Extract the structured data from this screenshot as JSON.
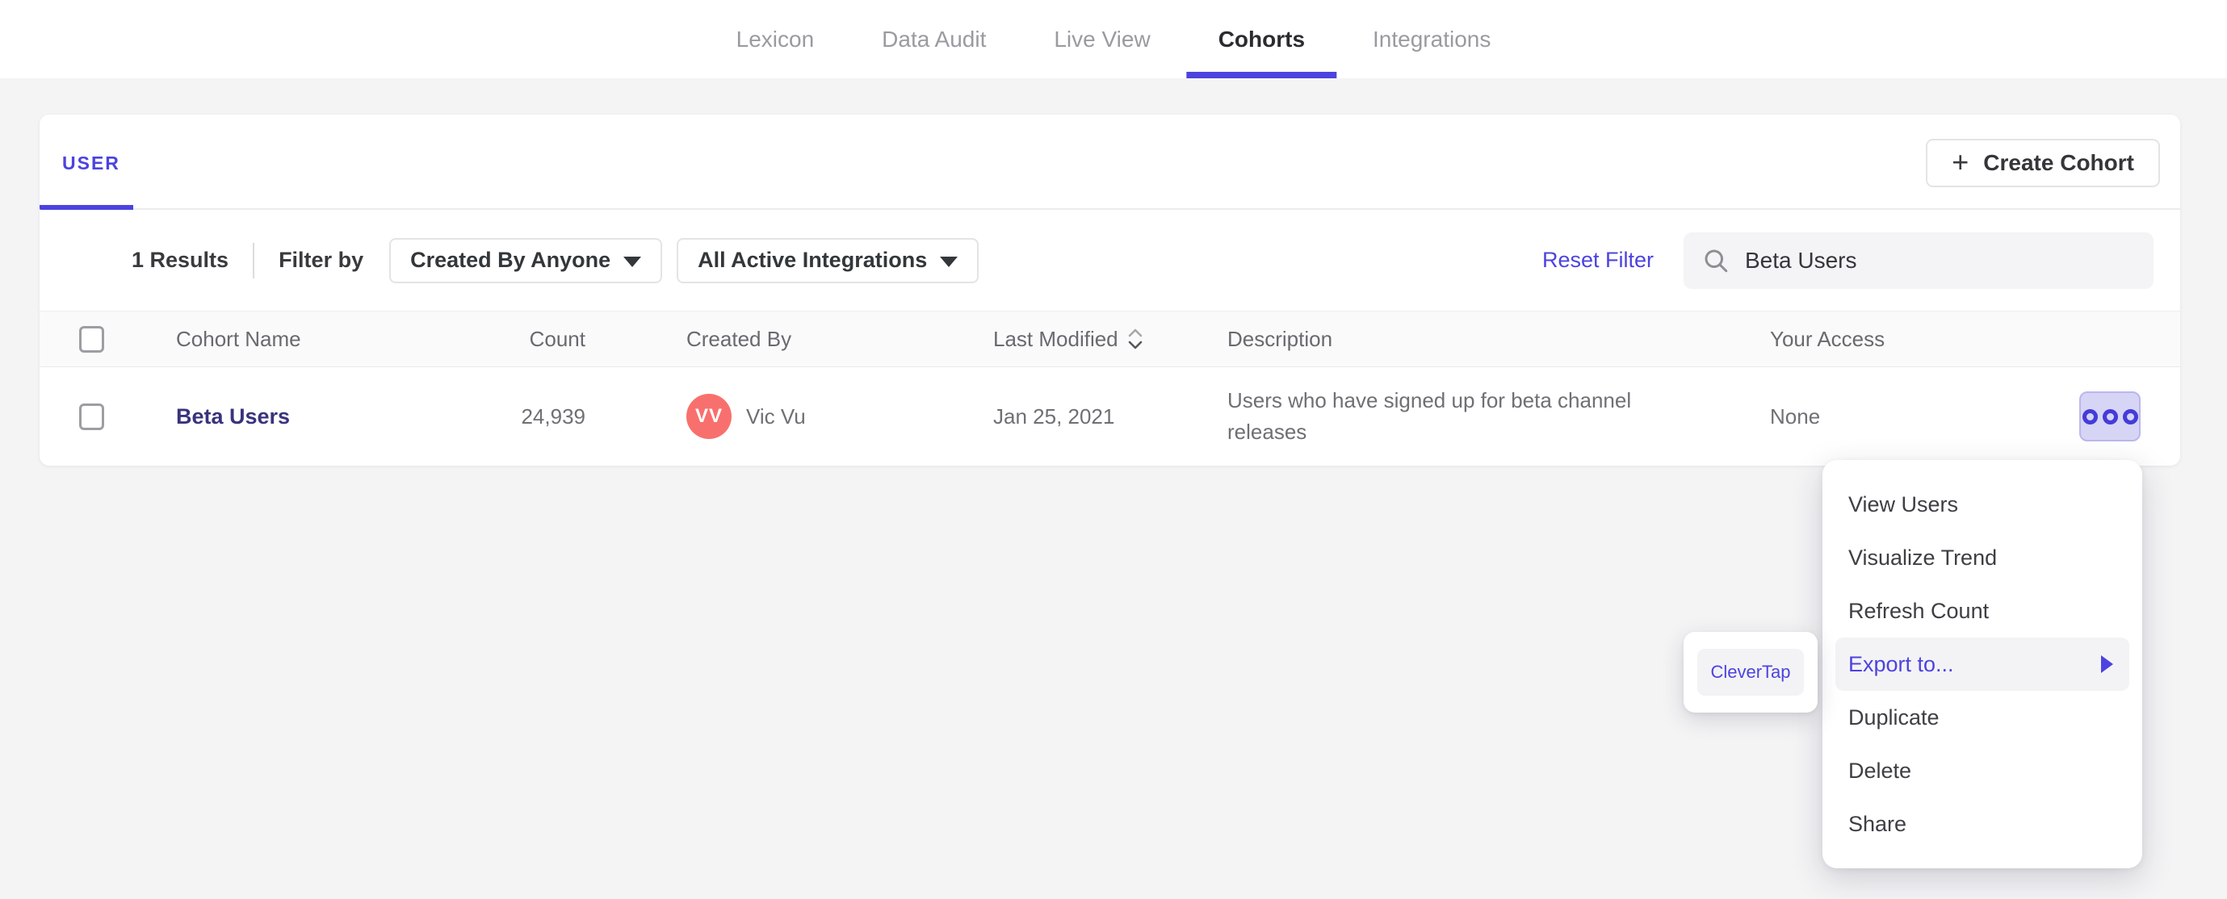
{
  "colors": {
    "accent": "#4c43e0",
    "cohort_link": "#39337d",
    "avatar_bg": "#f8706d",
    "page_bg": "#f4f4f5",
    "ooo_btn_bg": "#d7d5f5"
  },
  "nav": {
    "items": [
      {
        "label": "Lexicon",
        "active": false
      },
      {
        "label": "Data Audit",
        "active": false
      },
      {
        "label": "Live View",
        "active": false
      },
      {
        "label": "Cohorts",
        "active": true
      },
      {
        "label": "Integrations",
        "active": false
      }
    ]
  },
  "card": {
    "tab_label": "USER",
    "create_button": {
      "plus": "+",
      "label": "Create Cohort"
    },
    "filters": {
      "results_count": "1 Results",
      "filter_by_label": "Filter by",
      "created_by_dropdown": "Created By Anyone",
      "integrations_dropdown": "All Active Integrations",
      "reset_link": "Reset Filter",
      "search_icon": "search-icon",
      "search_value": "Beta Users"
    },
    "table": {
      "headers": {
        "name": "Cohort Name",
        "count": "Count",
        "created_by": "Created By",
        "last_modified": "Last Modified",
        "description": "Description",
        "access": "Your Access"
      },
      "row": {
        "name": "Beta Users",
        "count": "24,939",
        "avatar_initials": "VV",
        "created_by": "Vic Vu",
        "last_modified": "Jan 25, 2021",
        "description": "Users who have signed up for beta channel releases",
        "access": "None"
      }
    }
  },
  "menu": {
    "items": [
      "View Users",
      "Visualize Trend",
      "Refresh Count",
      "Export to...",
      "Duplicate",
      "Delete",
      "Share"
    ],
    "highlighted_item": "Export to..."
  },
  "submenu": {
    "items": [
      "CleverTap"
    ]
  }
}
